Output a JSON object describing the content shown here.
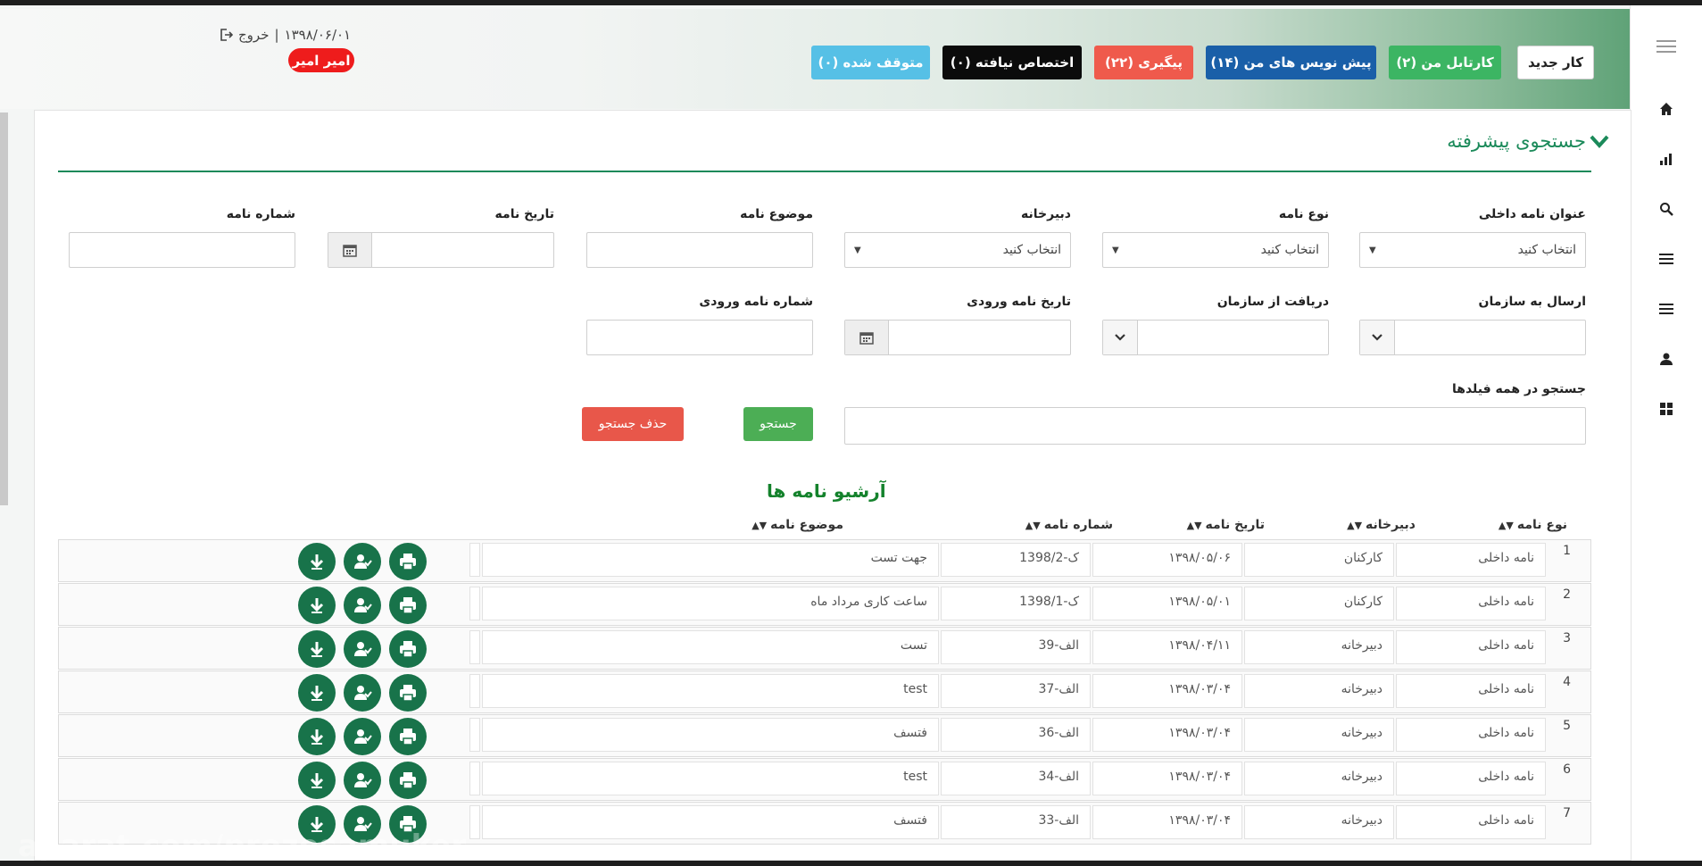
{
  "header": {
    "buttons": [
      {
        "label": "کار جدید",
        "bg": "#ffffff",
        "color": "#222222",
        "border": "#cfcfcf"
      },
      {
        "label": "کارتابل من (۲)",
        "bg": "#3cb563",
        "color": "#ffffff",
        "border": "#3cb563"
      },
      {
        "label": "پیش نویس های من (۱۴)",
        "bg": "#1a5fa8",
        "color": "#ffffff",
        "border": "#1a5fa8"
      },
      {
        "label": "پیگیری (۲۲)",
        "bg": "#ef5a4c",
        "color": "#ffffff",
        "border": "#ef5a4c"
      },
      {
        "label": "اختصاص نیافته (۰)",
        "bg": "#0b0b0b",
        "color": "#ffffff",
        "border": "#0b0b0b"
      },
      {
        "label": "متوقف شده (۰)",
        "bg": "#56c0e6",
        "color": "#ffffff",
        "border": "#56c0e6"
      }
    ],
    "date": "۱۳۹۸/۰۶/۰۱",
    "separator": "|",
    "logout": "خروج",
    "user": "امیر امیر"
  },
  "search": {
    "title": "جستجوی پیشرفته",
    "fields": {
      "internal_title": {
        "label": "عنوان نامه داخلی",
        "value": "انتخاب کنید"
      },
      "letter_type": {
        "label": "نوع نامه",
        "value": "انتخاب کنید"
      },
      "secretariat": {
        "label": "دبیرخانه",
        "value": "انتخاب کنید"
      },
      "subject": {
        "label": "موضوع نامه",
        "value": ""
      },
      "letter_date": {
        "label": "تاریخ نامه",
        "value": ""
      },
      "letter_number": {
        "label": "شماره نامه",
        "value": ""
      },
      "send_to_org": {
        "label": "ارسال به سازمان",
        "value": ""
      },
      "receive_from_org": {
        "label": "دریافت از سازمان",
        "value": ""
      },
      "incoming_date": {
        "label": "تاریخ نامه ورودی",
        "value": ""
      },
      "incoming_number": {
        "label": "شماره نامه ورودی",
        "value": ""
      },
      "all_fields": {
        "label": "جستجو در همه فیلدها",
        "value": ""
      }
    },
    "search_button": "جستجو",
    "clear_button": "حذف جستجو"
  },
  "archive": {
    "title": "آرشیو نامه ها",
    "columns": [
      "نوع نامه",
      "دبیرخانه",
      "تاریخ نامه",
      "شماره نامه",
      "موضوع نامه"
    ],
    "rows": [
      {
        "n": "1",
        "type": "نامه داخلی",
        "secretariat": "کارکنان",
        "date": "۱۳۹۸/۰۵/۰۶",
        "number": "ک-1398/2",
        "subject": "جهت تست"
      },
      {
        "n": "2",
        "type": "نامه داخلی",
        "secretariat": "کارکنان",
        "date": "۱۳۹۸/۰۵/۰۱",
        "number": "ک-1398/1",
        "subject": "ساعت کاری مرداد ماه"
      },
      {
        "n": "3",
        "type": "نامه داخلی",
        "secretariat": "دبیرخانه",
        "date": "۱۳۹۸/۰۴/۱۱",
        "number": "الف-39",
        "subject": "تست"
      },
      {
        "n": "4",
        "type": "نامه داخلی",
        "secretariat": "دبیرخانه",
        "date": "۱۳۹۸/۰۳/۰۴",
        "number": "الف-37",
        "subject": "test"
      },
      {
        "n": "5",
        "type": "نامه داخلی",
        "secretariat": "دبیرخانه",
        "date": "۱۳۹۸/۰۳/۰۴",
        "number": "الف-36",
        "subject": "فتسف"
      },
      {
        "n": "6",
        "type": "نامه داخلی",
        "secretariat": "دبیرخانه",
        "date": "۱۳۹۸/۰۳/۰۴",
        "number": "الف-34",
        "subject": "test"
      },
      {
        "n": "7",
        "type": "نامه داخلی",
        "secretariat": "دبیرخانه",
        "date": "۱۳۹۸/۰۳/۰۴",
        "number": "الف-33",
        "subject": "فتسف"
      }
    ]
  },
  "watermark": "aparat.com/prozesamuker",
  "colors": {
    "accent": "#1b8a5a",
    "action_green": "#18734a",
    "danger": "#e8574a",
    "search_green": "#4cae55"
  },
  "sidebar_icons": [
    "menu-icon",
    "home-icon",
    "chart-icon",
    "search-icon",
    "list-icon",
    "list-icon",
    "user-icon",
    "grid-icon"
  ]
}
